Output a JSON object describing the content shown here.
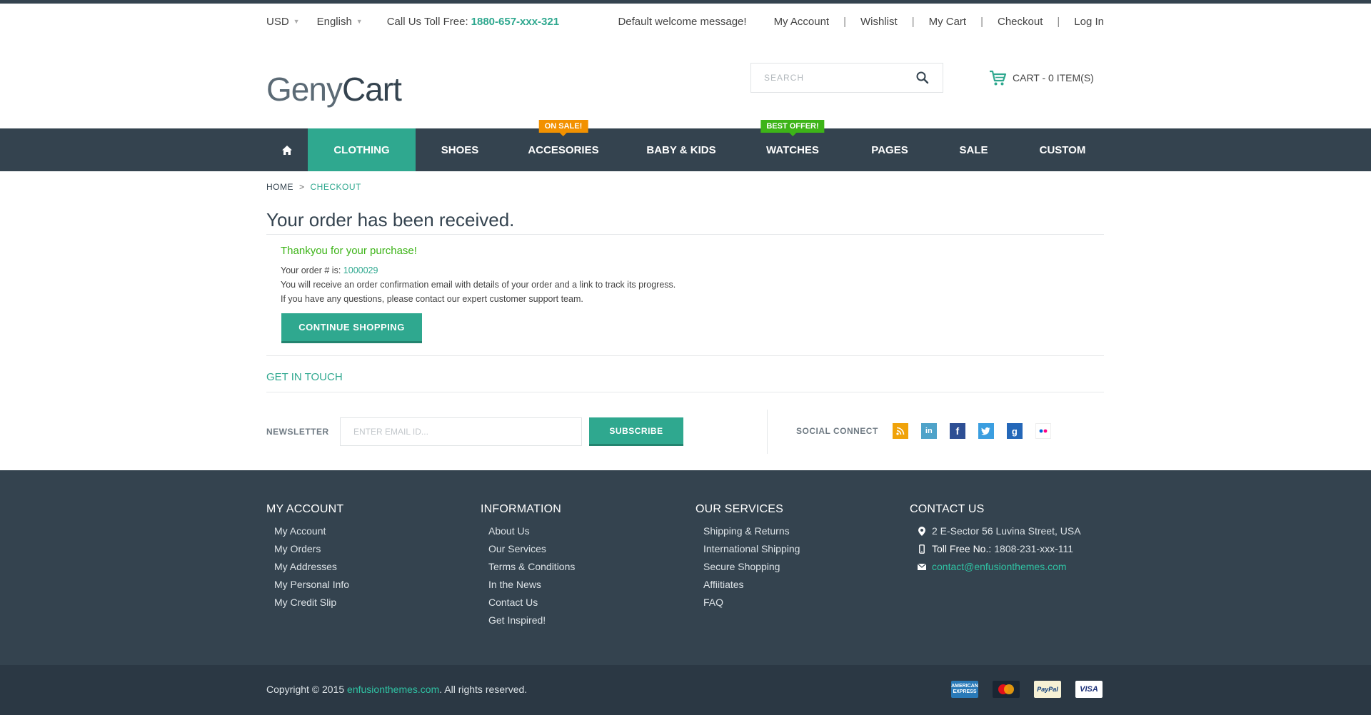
{
  "topbar": {
    "currency": "USD",
    "language": "English",
    "phone_label": "Call Us Toll Free:",
    "phone": "1880-657-xxx-321",
    "welcome": "Default welcome message!",
    "links": [
      "My Account",
      "Wishlist",
      "My Cart",
      "Checkout",
      "Log In"
    ]
  },
  "header": {
    "logo_light": "Geny",
    "logo_bold": "Cart",
    "search_placeholder": "SEARCH",
    "cart_label": "CART - 0 ITEM(S)"
  },
  "nav": {
    "items": [
      "CLOTHING",
      "SHOES",
      "ACCESORIES",
      "BABY & KIDS",
      "WATCHES",
      "PAGES",
      "SALE",
      "CUSTOM"
    ],
    "active": "CLOTHING",
    "badges": {
      "sale": "ON SALE!",
      "offer": "BEST OFFER!"
    }
  },
  "breadcrumb": {
    "home": "HOME",
    "separator": ">",
    "current": "CHECKOUT"
  },
  "order": {
    "title": "Your order has been received.",
    "thanks": "Thankyou for your purchase!",
    "order_label": "Your order # is:",
    "order_number": "1000029",
    "line1": "You will receive an order confirmation email with details of your order and a link to track its progress.",
    "line2": "If you have any questions, please contact our expert customer support team.",
    "continue_label": "CONTINUE SHOPPING"
  },
  "touch": {
    "title": "GET IN TOUCH",
    "newsletter_label": "NEWSLETTER",
    "email_placeholder": "ENTER EMAIL ID...",
    "subscribe_label": "SUBSCRIBE",
    "social_label": "SOCIAL CONNECT",
    "social_icons": [
      "rss-icon",
      "linkedin-icon",
      "facebook-icon",
      "twitter-icon",
      "google-plus-icon",
      "flickr-icon"
    ]
  },
  "footer": {
    "account": {
      "title": "MY ACCOUNT",
      "items": [
        "My Account",
        "My Orders",
        "My Addresses",
        "My Personal Info",
        "My Credit Slip"
      ]
    },
    "information": {
      "title": "INFORMATION",
      "items": [
        "About Us",
        "Our Services",
        "Terms & Conditions",
        "In the News",
        "Contact Us",
        "Get Inspired!"
      ]
    },
    "services": {
      "title": "OUR SERVICES",
      "items": [
        "Shipping & Returns",
        "International Shipping",
        "Secure Shopping",
        "Affiitiates",
        "FAQ"
      ]
    },
    "contact": {
      "title": "CONTACT US",
      "address": "2 E-Sector 56 Luvina Street, USA",
      "tollfree_label": "Toll Free No.:",
      "tollfree": "1808-231-xxx-111",
      "email": "contact@enfusionthemes.com"
    }
  },
  "bottom": {
    "copyright_prefix": "Copyright © 2015",
    "copyright_link": "enfusionthemes.com",
    "copyright_suffix": ". All rights reserved.",
    "payments": [
      "american-express-icon",
      "mastercard-icon",
      "paypal-icon",
      "visa-icon"
    ],
    "amex_text": "AMERICAN EXPRESS",
    "paypal_text": "PayPal",
    "visa_text": "VISA"
  },
  "colors": {
    "accent": "#2fa88f",
    "dark": "#34434f",
    "sale_badge": "#f29100",
    "offer_badge": "#3db418"
  }
}
